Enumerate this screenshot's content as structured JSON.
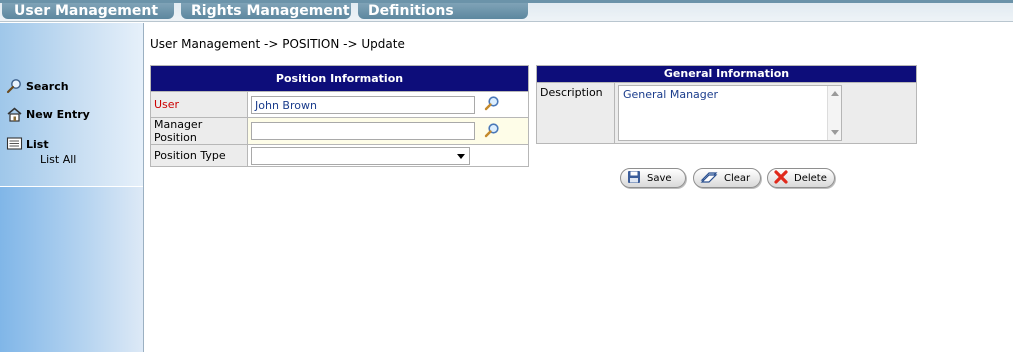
{
  "tabs": [
    {
      "label": "User Management"
    },
    {
      "label": "Rights Management"
    },
    {
      "label": "Definitions"
    }
  ],
  "sidebar": {
    "search": "Search",
    "new_entry": "New Entry",
    "list": "List",
    "list_all": "List All"
  },
  "breadcrumb": "User Management -> POSITION -> Update",
  "position_info": {
    "title": "Position Information",
    "user_label": "User",
    "user_value": "John Brown",
    "manager_label": "Manager Position",
    "manager_value": "",
    "type_label": "Position Type",
    "type_value": ""
  },
  "general_info": {
    "title": "General Information",
    "description_label": "Description",
    "description_value": "General Manager"
  },
  "buttons": {
    "save": "Save",
    "clear": "Clear",
    "delete": "Delete"
  },
  "colors": {
    "panel_header": "#0d0d7a",
    "required_label": "#cc0000",
    "tab_bg": "#6b93a9"
  },
  "icons": [
    "search-icon",
    "home-icon",
    "list-icon",
    "magnifier-icon",
    "save-disk-icon",
    "clear-icon",
    "delete-x-icon"
  ]
}
